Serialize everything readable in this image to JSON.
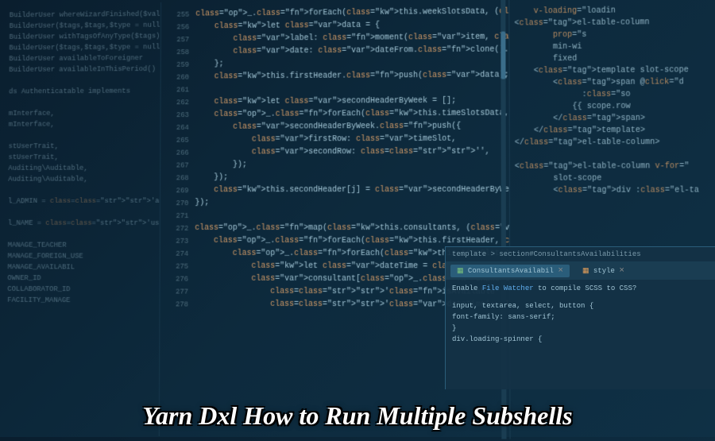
{
  "overlay": {
    "title": "Yarn Dxl How to Run Multiple Subshells"
  },
  "left": {
    "lines": [
      "BuilderUser whereWizardFinished($value)",
      "BuilderUser($tags,$tags,$type = null)",
      "BuilderUser withTagsOfAnyType($tags)",
      "BuilderUser($tags,$tags,$type = null)",
      "BuilderUser availableToForeigner",
      "BuilderUser availableInThisPeriod()",
      "",
      "ds Authenticatable implements",
      "",
      "mInterface,",
      "mInterface,",
      "",
      "stUserTrait,",
      "stUserTrait,",
      "Auditing\\Auditable,",
      "Auditing\\Auditable,",
      "",
      "l_ADMIN = 'admin';",
      "",
      "l_NAME = 'users';",
      "",
      "MANAGE_TEACHER",
      "MANAGE_FOREIGN_USE",
      "MANAGE_AVAILABIL",
      "OWNER_ID",
      "COLLABORATOR_ID",
      "FACILITY_MANAGE"
    ]
  },
  "gutter": {
    "start": 255
  },
  "main": {
    "lines": [
      "_.forEach(this.weekSlotsData, (item, j) => {",
      "    let data = {",
      "        label: moment(item, 'ddd').format('dddd'),",
      "        date: dateFrom.clone().add(j, 'days').format(this.M",
      "    };",
      "    this.firstHeader.push(data);",
      "",
      "    let secondHeaderByWeek = [];",
      "    _.forEach(this.timeSlotsData, (timeSlot, i) => {",
      "        secondHeaderByWeek.push({",
      "            firstRow: timeSlot,",
      "            secondRow: '',",
      "        });",
      "    });",
      "    this.secondHeader[j] = secondHeaderByWeek;",
      "});",
      "",
      "_.map(this.consultants, (consultant) => {",
      "    _.forEach(this.firstHeader, data => {",
      "        _.forEach(this.timeSlotsData, timeSlot => {",
      "            let dateTime = moment(data.date + ' ' + timeSlot",
      "            consultant[_.snakeCase(data.label + '_' + timeSlot",
      "                'isAvailable': this.isAvailable(consultant, d",
      "                'dateTime': dateTime,"
    ]
  },
  "right": {
    "lines": [
      "    v-loading=\"loadin",
      "<el-table-column",
      "        prop=\"s",
      "        min-wi",
      "        fixed",
      "    <template slot-scope",
      "        <span @click=\"d",
      "              :class=\"so",
      "            {{ scope.row",
      "        </span>",
      "    </template>",
      "</el-table-column>",
      "",
      "<el-table-column v-for=\"",
      "        slot-scope",
      "        <div :class=\"el-ta"
    ]
  },
  "bottomPanel": {
    "breadcrumb": "template > section#ConsultantsAvailabilities",
    "tabs": [
      {
        "label": "ConsultantsAvailabil",
        "active": true
      },
      {
        "label": "style",
        "active": false
      }
    ],
    "message": "Enable File Watcher to compile SCSS to CSS?",
    "code": [
      "input, textarea, select, button {",
      "  font-family: sans-serif;",
      "}",
      "div.loading-spinner {"
    ]
  }
}
